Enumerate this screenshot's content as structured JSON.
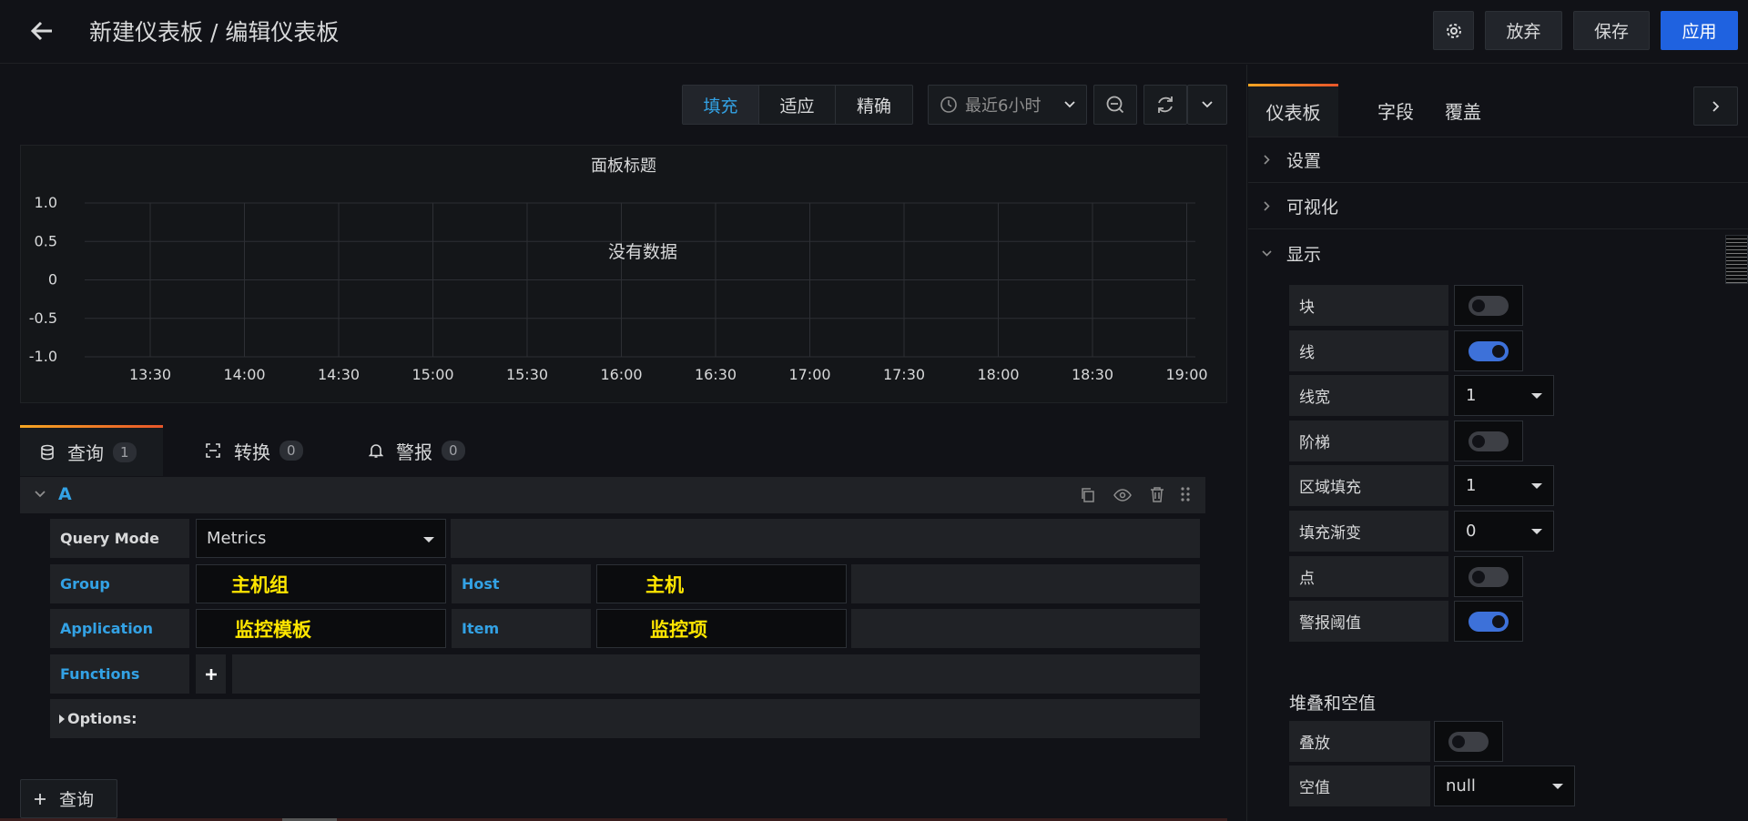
{
  "header": {
    "title": "新建仪表板 / 编辑仪表板",
    "discard_label": "放弃",
    "save_label": "保存",
    "apply_label": "应用"
  },
  "toolbar": {
    "view_modes": [
      "填充",
      "适应",
      "精确"
    ],
    "active_view_mode": "填充",
    "time_range": "最近6小时"
  },
  "panel": {
    "title": "面板标题",
    "no_data": "没有数据"
  },
  "chart_data": {
    "type": "line",
    "title": "面板标题",
    "x": [
      "13:30",
      "14:00",
      "14:30",
      "15:00",
      "15:30",
      "16:00",
      "16:30",
      "17:00",
      "17:30",
      "18:00",
      "18:30",
      "19:00"
    ],
    "y_ticks": [
      "1.0",
      "0.5",
      "0",
      "-0.5",
      "-1.0"
    ],
    "ylim": [
      -1.0,
      1.0
    ],
    "series": [],
    "grid": true,
    "annotation": "没有数据"
  },
  "query_tabs": [
    {
      "label": "查询",
      "count": "1"
    },
    {
      "label": "转换",
      "count": "0"
    },
    {
      "label": "警报",
      "count": "0"
    }
  ],
  "query": {
    "ref": "A",
    "query_mode_label": "Query Mode",
    "query_mode_value": "Metrics",
    "group_label": "Group",
    "group_value": "主机组",
    "host_label": "Host",
    "host_value": "主机",
    "application_label": "Application",
    "application_value": "监控模板",
    "item_label": "Item",
    "item_value": "监控项",
    "functions_label": "Functions",
    "options_label": "Options:",
    "add_query_label": "查询"
  },
  "options_panel": {
    "tabs": [
      "仪表板",
      "字段",
      "覆盖"
    ],
    "sections": [
      "设置",
      "可视化",
      "显示"
    ],
    "display_options": [
      {
        "label": "块",
        "type": "toggle",
        "on": false
      },
      {
        "label": "线",
        "type": "toggle",
        "on": true
      },
      {
        "label": "线宽",
        "type": "select",
        "value": "1"
      },
      {
        "label": "阶梯",
        "type": "toggle",
        "on": false
      },
      {
        "label": "区域填充",
        "type": "select",
        "value": "1"
      },
      {
        "label": "填充渐变",
        "type": "select",
        "value": "0"
      },
      {
        "label": "点",
        "type": "toggle",
        "on": false
      },
      {
        "label": "警报阈值",
        "type": "toggle",
        "on": true
      }
    ],
    "stack_title": "堆叠和空值",
    "stack_label": "叠放",
    "null_label": "空值",
    "null_value": "null"
  }
}
